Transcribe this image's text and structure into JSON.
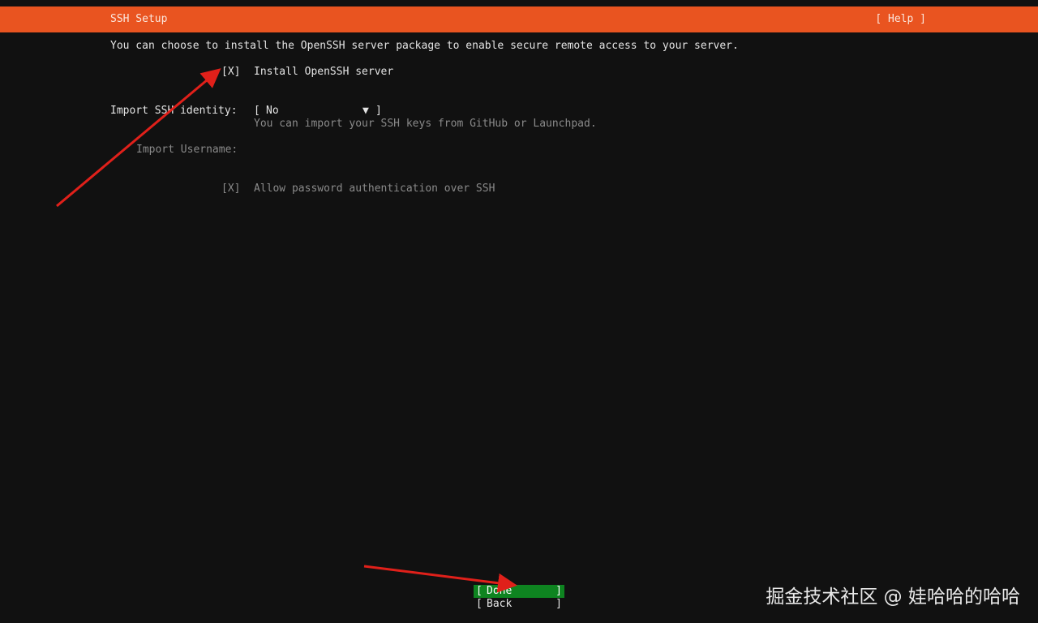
{
  "header": {
    "title": "SSH Setup",
    "help_label": "[ Help ]",
    "background": "#e95420"
  },
  "main": {
    "description": "You can choose to install the OpenSSH server package to enable secure remote access to your server.",
    "install_openssh": {
      "checkbox": "[X]",
      "label": "Install OpenSSH server",
      "checked": true
    },
    "import_identity": {
      "label": "Import SSH identity:",
      "bracket_open": "[",
      "value": "No",
      "arrow": "▼",
      "bracket_close": "]",
      "help": "You can import your SSH keys from GitHub or Launchpad."
    },
    "import_username": {
      "label": "Import Username:"
    },
    "allow_password": {
      "checkbox": "[X]",
      "label": "Allow password authentication over SSH",
      "checked": true
    }
  },
  "footer": {
    "done": {
      "left": "[",
      "label": "Done",
      "right": "]",
      "background": "#0e8420"
    },
    "back": {
      "left": "[",
      "label": "Back",
      "right": "]"
    }
  },
  "watermark": "掘金技术社区 @ 娃哈哈的哈哈",
  "annotation_color": "#e0201a"
}
